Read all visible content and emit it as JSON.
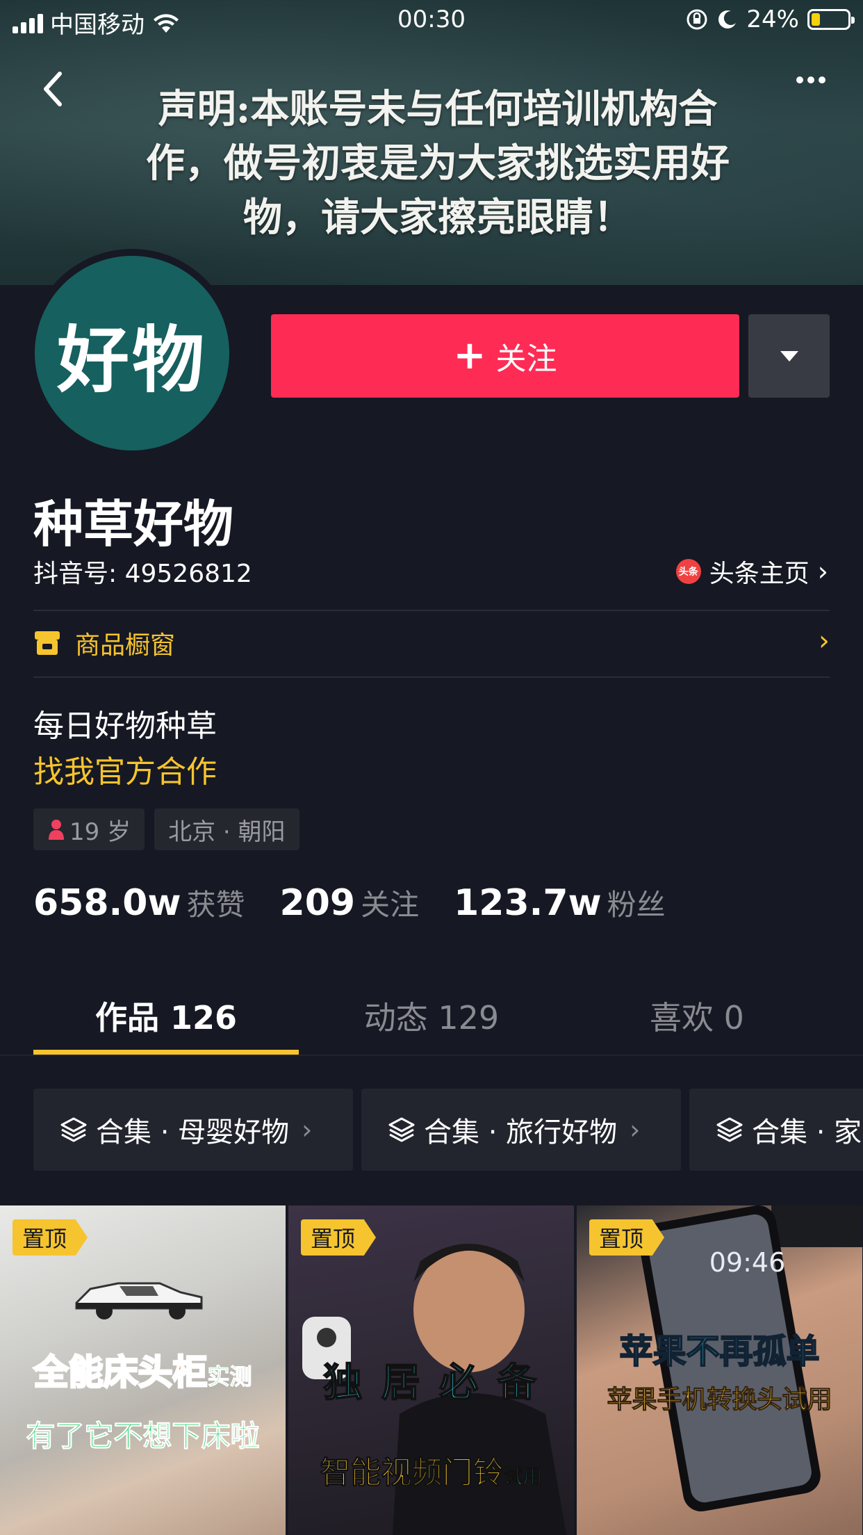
{
  "status_bar": {
    "carrier": "中国移动",
    "time": "00:30",
    "battery": "24%"
  },
  "banner": {
    "text": "声明:本账号未与任何培训机构合作，做号初衷是为大家挑选实用好物，请大家擦亮眼睛！",
    "back_icon": "chevron-left-icon",
    "more_icon": "more-dots-icon"
  },
  "profile": {
    "avatar_text": "好物",
    "follow_label": "关注",
    "nickname": "种草好物",
    "douyin_id": "抖音号: 49526812",
    "toutiao_badge": "头条",
    "toutiao_label": "头条主页",
    "shop_label": "商品橱窗",
    "bio_line1": "每日好物种草",
    "bio_line2": "找我官方合作",
    "age": "19 岁",
    "location": "北京 · 朝阳"
  },
  "stats": [
    {
      "value": "658.0w",
      "label": "获赞"
    },
    {
      "value": "209",
      "label": "关注"
    },
    {
      "value": "123.7w",
      "label": "粉丝"
    }
  ],
  "tabs": [
    {
      "label": "作品 126"
    },
    {
      "label": "动态 129"
    },
    {
      "label": "喜欢 0"
    }
  ],
  "collections": [
    {
      "label": "合集 · 母婴好物"
    },
    {
      "label": "合集 · 旅行好物"
    },
    {
      "label": "合集 · 家"
    }
  ],
  "videos": [
    {
      "pin": "置顶",
      "cap1": "全能床头柜",
      "cap1b": "实测",
      "cap2": "有了它不想下床啦"
    },
    {
      "pin": "置顶",
      "cap1": "独 居 必 备",
      "cap2": "智能视频门铃",
      "cap2b": "试用"
    },
    {
      "pin": "置顶",
      "lock_time": "09:46",
      "cap1": "苹果不再孤单",
      "cap2": "苹果手机转换头试用"
    }
  ],
  "colors": {
    "background": "#161823",
    "follow_red": "#fe2c55",
    "accent_yellow": "#f6c42e"
  }
}
